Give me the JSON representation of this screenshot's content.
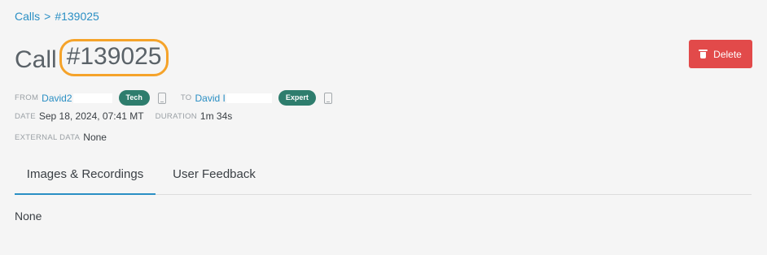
{
  "breadcrumb": {
    "parent": "Calls",
    "separator": ">",
    "current": "#139025"
  },
  "title": {
    "prefix": "Call",
    "id": "#139025"
  },
  "actions": {
    "delete_label": "Delete",
    "delete_color": "#e24a4a"
  },
  "call": {
    "from_label": "FROM",
    "from_name": "David2",
    "from_role": "Tech",
    "to_label": "TO",
    "to_name": "David I",
    "to_role": "Expert",
    "date_label": "DATE",
    "date_value": "Sep 18, 2024, 07:41 MT",
    "duration_label": "DURATION",
    "duration_value": "1m 34s",
    "external_label": "EXTERNAL DATA",
    "external_value": "None"
  },
  "tabs": [
    {
      "label": "Images & Recordings",
      "active": true
    },
    {
      "label": "User Feedback",
      "active": false
    }
  ],
  "content": {
    "text": "None"
  },
  "colors": {
    "accent": "#2a8fc4",
    "badge": "#2e7d6d",
    "highlight": "#f5a32a"
  },
  "icons": {
    "delete": "trash-icon",
    "device": "phone-icon"
  }
}
